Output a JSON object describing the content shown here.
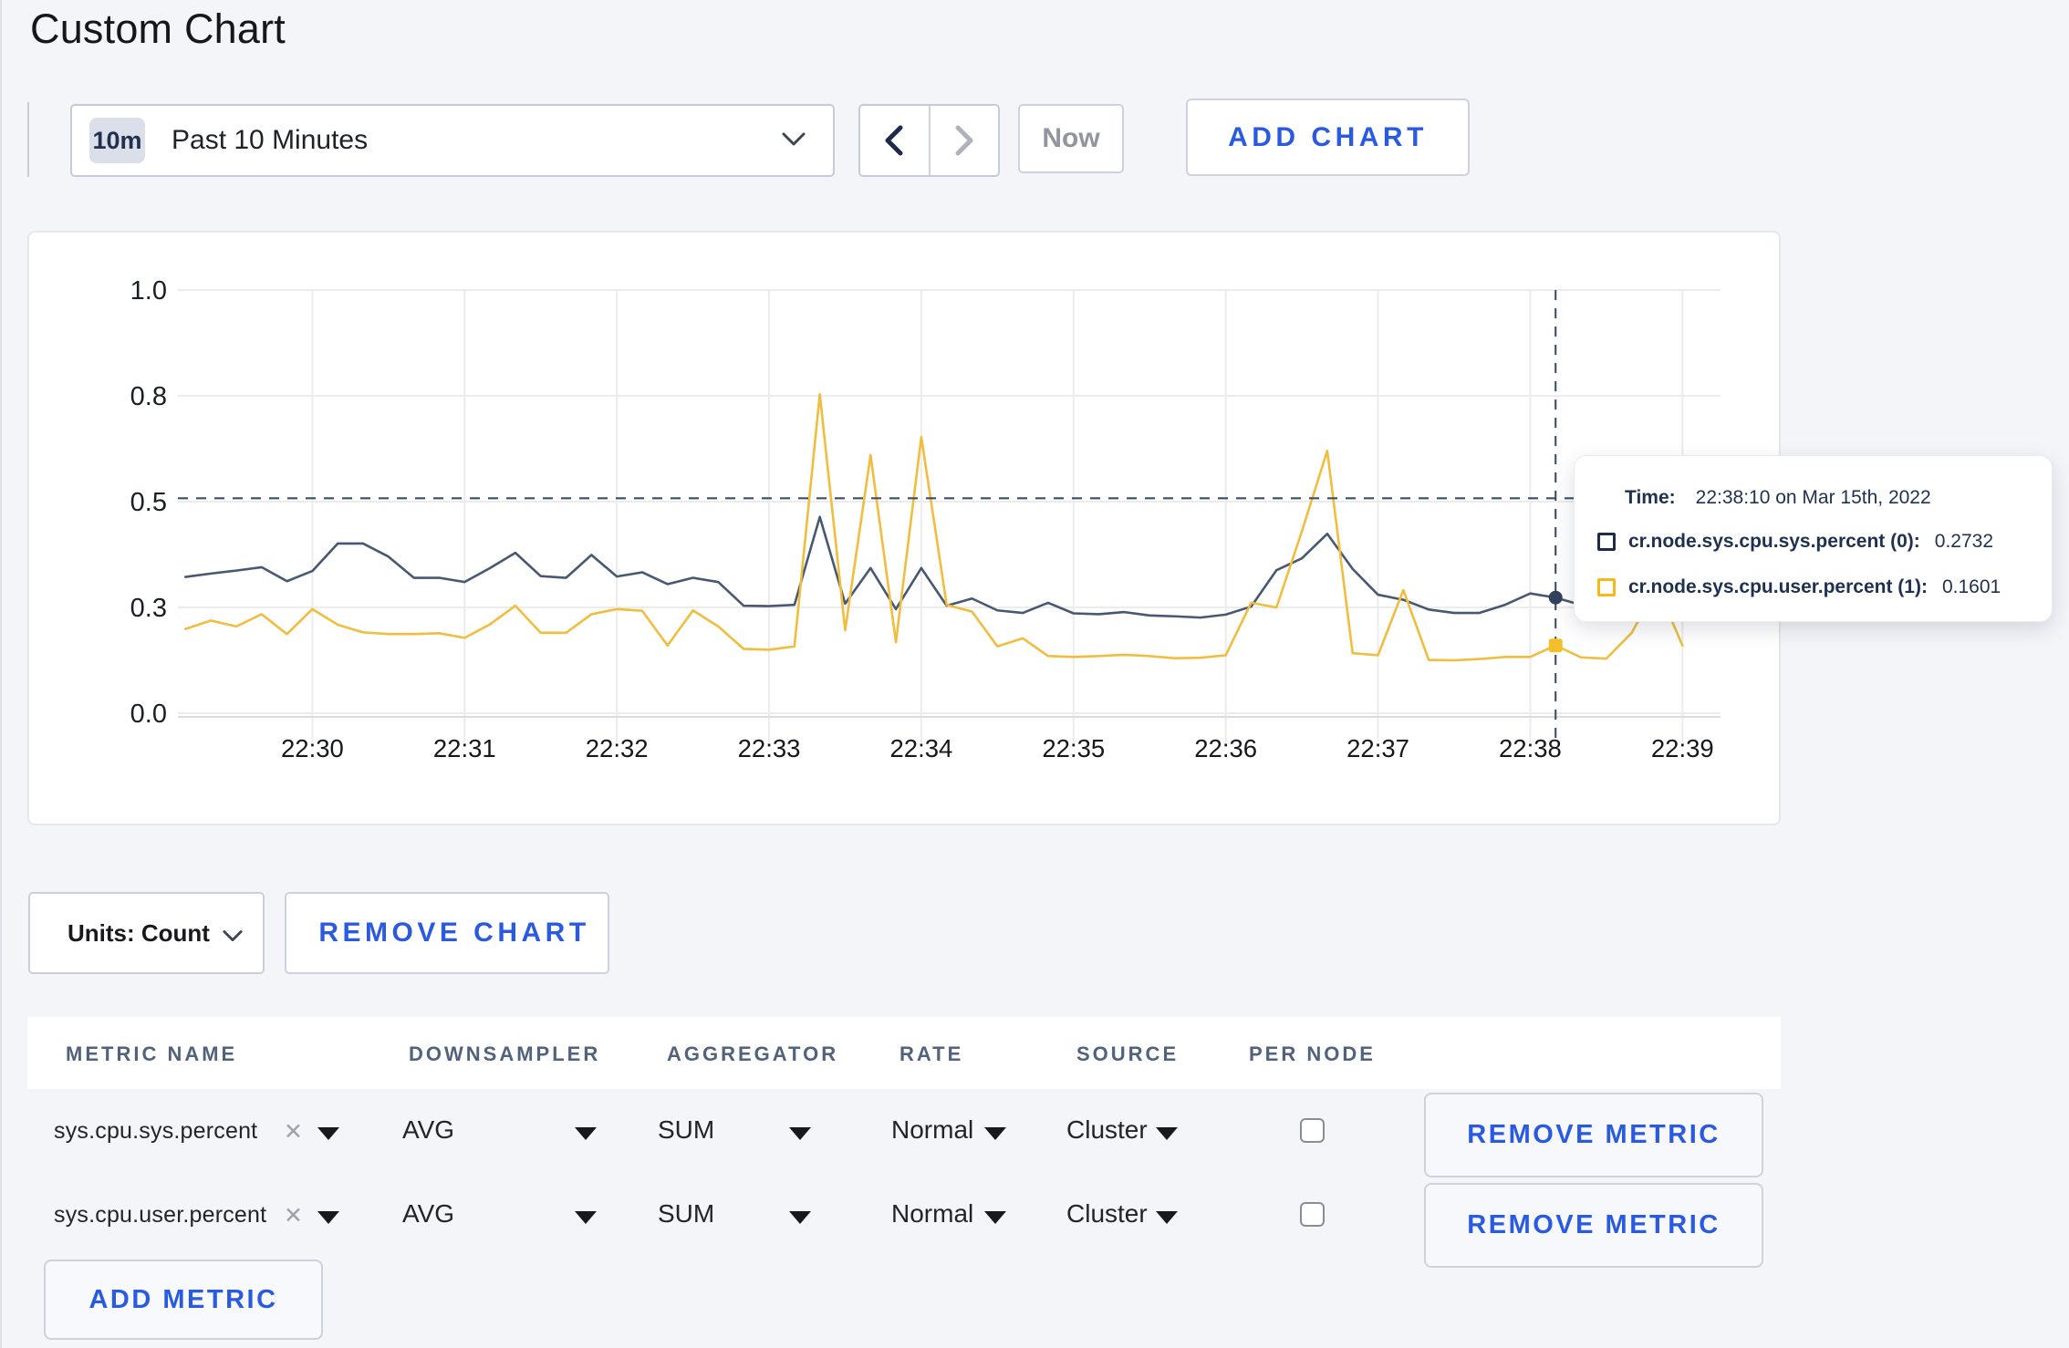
{
  "title": "Custom Chart",
  "controls": {
    "range_badge": "10m",
    "range_label": "Past 10 Minutes",
    "now_label": "Now",
    "add_chart_label": "ADD CHART"
  },
  "chart_data": {
    "type": "line",
    "title": "",
    "xlabel": "",
    "ylabel": "",
    "ylim": [
      0,
      1
    ],
    "y_ticks": [
      0,
      0.25,
      0.5,
      0.75,
      1.0
    ],
    "y_tick_labels": [
      "0.0",
      "0.3",
      "0.5",
      "0.8",
      "1.0"
    ],
    "x_tick_labels": [
      "22:30",
      "22:31",
      "22:32",
      "22:33",
      "22:34",
      "22:35",
      "22:36",
      "22:37",
      "22:38",
      "22:39"
    ],
    "grid": "on",
    "x_times": [
      "22:29:10",
      "22:29:20",
      "22:29:30",
      "22:29:40",
      "22:29:50",
      "22:30:00",
      "22:30:10",
      "22:30:20",
      "22:30:30",
      "22:30:40",
      "22:30:50",
      "22:31:00",
      "22:31:10",
      "22:31:20",
      "22:31:30",
      "22:31:40",
      "22:31:50",
      "22:32:00",
      "22:32:10",
      "22:32:20",
      "22:32:30",
      "22:32:40",
      "22:32:50",
      "22:33:00",
      "22:33:10",
      "22:33:20",
      "22:33:30",
      "22:33:40",
      "22:33:50",
      "22:34:00",
      "22:34:10",
      "22:34:20",
      "22:34:30",
      "22:34:40",
      "22:34:50",
      "22:35:00",
      "22:35:10",
      "22:35:20",
      "22:35:30",
      "22:35:40",
      "22:35:50",
      "22:36:00",
      "22:36:10",
      "22:36:20",
      "22:36:30",
      "22:36:40",
      "22:36:50",
      "22:37:00",
      "22:37:10",
      "22:37:20",
      "22:37:30",
      "22:37:40",
      "22:37:50",
      "22:38:00",
      "22:38:10",
      "22:38:20",
      "22:38:30",
      "22:38:40",
      "22:38:50",
      "22:39:00"
    ],
    "series": [
      {
        "name": "cr.node.sys.cpu.sys.percent (0)",
        "color": "#475872",
        "values": [
          0.322,
          0.33,
          0.337,
          0.345,
          0.312,
          0.336,
          0.401,
          0.401,
          0.37,
          0.32,
          0.32,
          0.31,
          0.343,
          0.379,
          0.324,
          0.32,
          0.374,
          0.323,
          0.333,
          0.305,
          0.32,
          0.31,
          0.254,
          0.253,
          0.256,
          0.464,
          0.259,
          0.343,
          0.246,
          0.343,
          0.254,
          0.271,
          0.243,
          0.237,
          0.261,
          0.236,
          0.234,
          0.239,
          0.231,
          0.229,
          0.226,
          0.233,
          0.252,
          0.338,
          0.366,
          0.424,
          0.341,
          0.28,
          0.268,
          0.245,
          0.237,
          0.237,
          0.256,
          0.283,
          0.2732,
          0.256,
          0.25,
          0.25,
          0.25,
          0.25
        ]
      },
      {
        "name": "cr.node.sys.cpu.user.percent (1)",
        "color": "#f0bd3e",
        "values": [
          0.199,
          0.219,
          0.205,
          0.234,
          0.187,
          0.246,
          0.209,
          0.191,
          0.187,
          0.187,
          0.189,
          0.178,
          0.21,
          0.254,
          0.19,
          0.19,
          0.234,
          0.246,
          0.242,
          0.16,
          0.243,
          0.205,
          0.152,
          0.15,
          0.158,
          0.754,
          0.196,
          0.61,
          0.168,
          0.653,
          0.256,
          0.24,
          0.158,
          0.177,
          0.135,
          0.133,
          0.135,
          0.138,
          0.135,
          0.13,
          0.131,
          0.137,
          0.261,
          0.25,
          0.43,
          0.62,
          0.142,
          0.137,
          0.291,
          0.126,
          0.125,
          0.128,
          0.133,
          0.133,
          0.1601,
          0.132,
          0.129,
          0.19,
          0.3,
          0.16
        ]
      }
    ],
    "hover": {
      "time_index": 54,
      "crosshair_y_value": 0.508
    }
  },
  "tooltip": {
    "time_label": "Time:",
    "time_value": "22:38:10 on Mar 15th, 2022",
    "entries": [
      {
        "label": "cr.node.sys.cpu.sys.percent (0):",
        "value": "0.2732",
        "color": "#1c2b49"
      },
      {
        "label": "cr.node.sys.cpu.user.percent (1):",
        "value": "0.1601",
        "color": "#f5ba18"
      }
    ]
  },
  "units_bar": {
    "units_label": "Units: Count",
    "remove_chart_label": "REMOVE CHART"
  },
  "table": {
    "headers": [
      "METRIC NAME",
      "DOWNSAMPLER",
      "AGGREGATOR",
      "RATE",
      "SOURCE",
      "PER NODE"
    ],
    "rows": [
      {
        "metric_name": "sys.cpu.sys.percent",
        "downsampler": "AVG",
        "aggregator": "SUM",
        "rate": "Normal",
        "source": "Cluster",
        "per_node_checked": false,
        "remove_label": "REMOVE METRIC"
      },
      {
        "metric_name": "sys.cpu.user.percent",
        "downsampler": "AVG",
        "aggregator": "SUM",
        "rate": "Normal",
        "source": "Cluster",
        "per_node_checked": false,
        "remove_label": "REMOVE METRIC"
      }
    ],
    "add_metric_label": "ADD METRIC"
  },
  "colors": {
    "accent_blue": "#2a5ae0",
    "series_navy": "#475872",
    "series_yellow": "#f0bd3e",
    "page_bg": "#f4f5f9",
    "crosshair": "#34495e"
  }
}
